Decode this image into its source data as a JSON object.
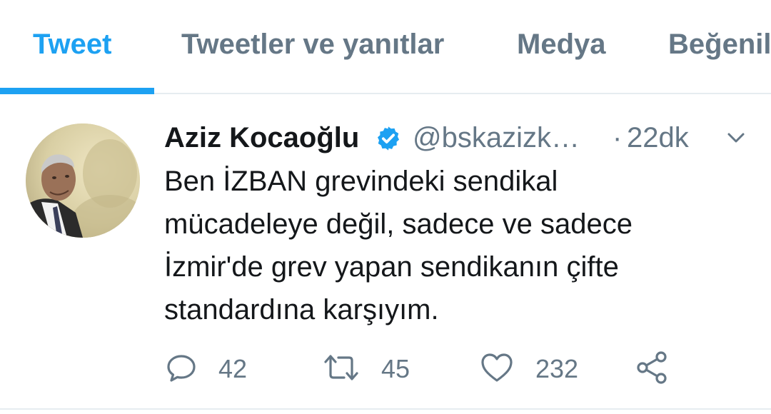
{
  "tabs": [
    {
      "label": "Tweet"
    },
    {
      "label": "Tweetler ve yanıtlar"
    },
    {
      "label": "Medya"
    },
    {
      "label": "Beğeniler"
    }
  ],
  "tweet": {
    "name": "Aziz Kocaoğlu",
    "handle": "@bskazizk…",
    "separator": "·",
    "time": "22dk",
    "text_lines": [
      "Ben İZBAN grevindeki sendikal",
      "mücadeleye değil, sadece ve sadece",
      "İzmir'de grev yapan sendikanın çifte",
      "standardına karşıyım."
    ],
    "stats": {
      "replies": "42",
      "retweets": "45",
      "likes": "232"
    }
  },
  "colors": {
    "accent": "#1da1f2",
    "muted": "#657786",
    "text": "#14171a",
    "divider": "#e6ecf0"
  },
  "icons": {
    "verified": "verified-badge-icon",
    "caret": "chevron-down-icon",
    "reply": "reply-icon",
    "retweet": "retweet-icon",
    "like": "heart-icon",
    "share": "share-icon"
  }
}
